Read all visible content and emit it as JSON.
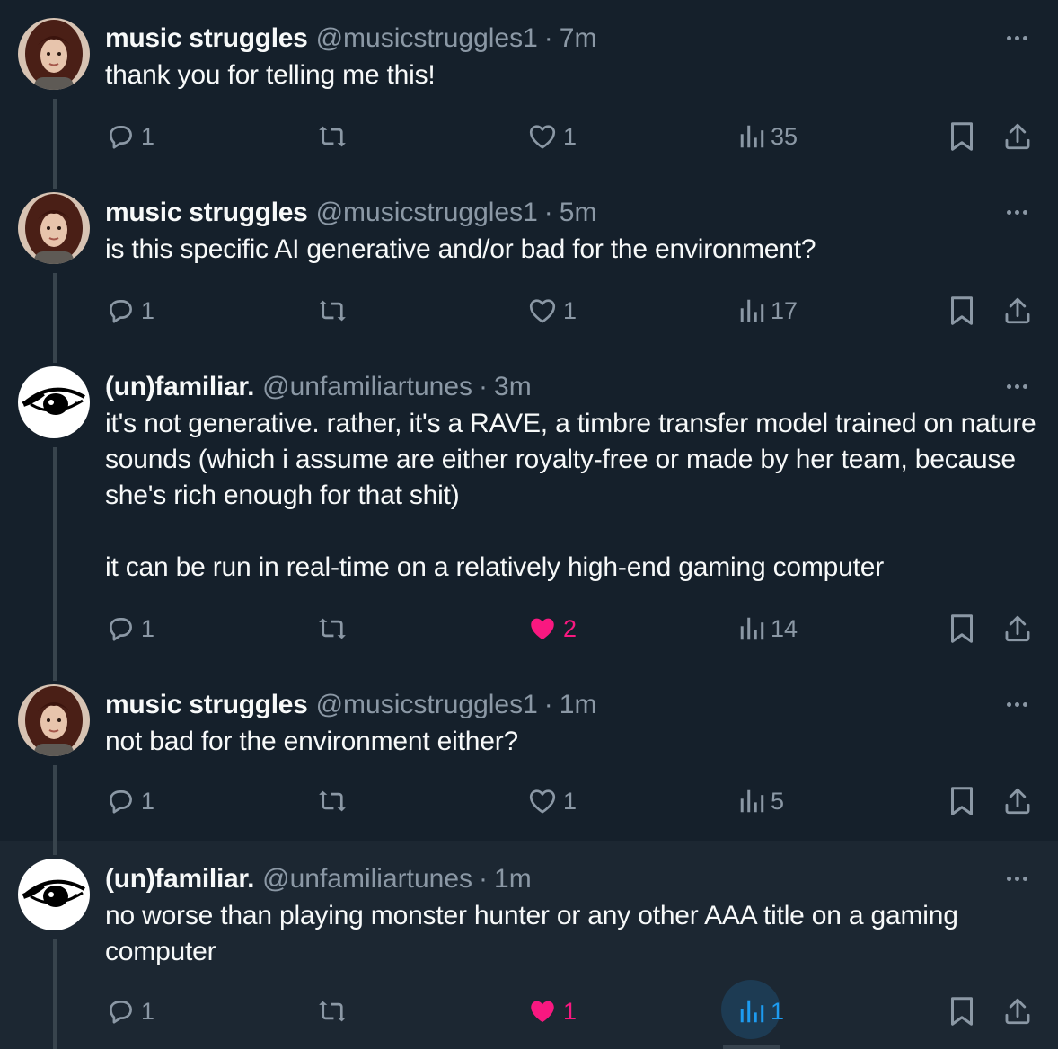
{
  "colors": {
    "background": "#15202b",
    "highlight_background": "#1c2732",
    "text_primary": "#f7f9f9",
    "text_secondary": "#8b98a5",
    "like_pink": "#f91880",
    "accent_blue": "#1d9bf0",
    "thread_line": "#38444d"
  },
  "tweets": [
    {
      "name": "music struggles",
      "handle": "@musicstruggles1",
      "separator": "·",
      "time": "7m",
      "text": [
        "thank you for telling me this!"
      ],
      "replies": "1",
      "retweets": "",
      "likes": "1",
      "liked": false,
      "views": "35",
      "avatar": "woman-portrait-avatar"
    },
    {
      "name": "music struggles",
      "handle": "@musicstruggles1",
      "separator": "·",
      "time": "5m",
      "text": [
        "is this specific AI generative and/or bad for the environment?"
      ],
      "replies": "1",
      "retweets": "",
      "likes": "1",
      "liked": false,
      "views": "17",
      "avatar": "woman-portrait-avatar"
    },
    {
      "name": "(un)familiar.",
      "handle": "@unfamiliartunes",
      "separator": "·",
      "time": "3m",
      "text": [
        "it's not generative. rather, it's a RAVE, a timbre transfer model trained on nature sounds (which i assume are either royalty-free or made by her team, because she's rich enough for that shit)",
        "it can be run in real-time on a relatively high-end gaming computer"
      ],
      "replies": "1",
      "retweets": "",
      "likes": "2",
      "liked": true,
      "views": "14",
      "avatar": "eye-logo-avatar"
    },
    {
      "name": "music struggles",
      "handle": "@musicstruggles1",
      "separator": "·",
      "time": "1m",
      "text": [
        "not bad for the environment either?"
      ],
      "replies": "1",
      "retweets": "",
      "likes": "1",
      "liked": false,
      "views": "5",
      "avatar": "woman-portrait-avatar"
    },
    {
      "name": "(un)familiar.",
      "handle": "@unfamiliartunes",
      "separator": "·",
      "time": "1m",
      "text": [
        "no worse than playing monster hunter or any other AAA title on a gaming computer"
      ],
      "replies": "1",
      "retweets": "",
      "likes": "1",
      "liked": true,
      "views": "1",
      "avatar": "eye-logo-avatar"
    }
  ],
  "icons": {
    "reply": "reply-bubble-icon",
    "retweet": "retweet-icon",
    "like": "heart-icon",
    "views": "views-bar-chart-icon",
    "bookmark": "bookmark-icon",
    "share": "share-upload-icon",
    "more": "more-dots-icon"
  }
}
